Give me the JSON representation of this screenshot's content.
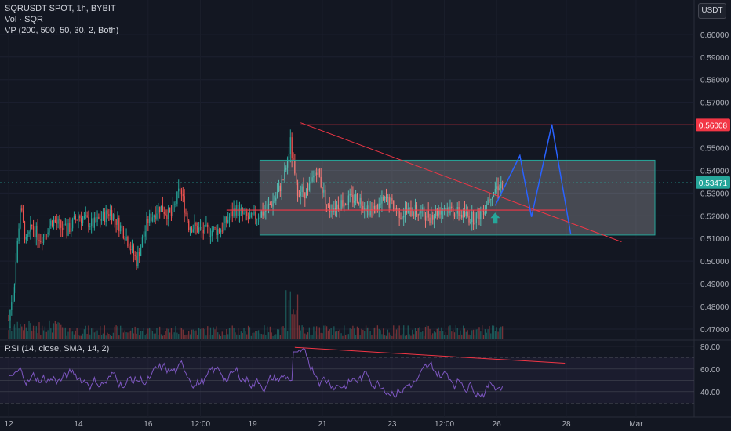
{
  "header": {
    "symbol_line": "SQRUSDT SPOT, 1h, BYBIT",
    "volume_line": "Vol · SQR",
    "vp_line": "VP (200, 500, 50, 30, 2, Both)",
    "currency_button": "USDT"
  },
  "rsi_legend": "RSI (14, close, SMA, 14, 2)",
  "colors": {
    "up": "#26a69a",
    "down": "#ef5350",
    "bg": "#131722",
    "box_fill": "#ffffff",
    "box_border": "#26a69a",
    "trend": "#f23645",
    "arrow": "#2962ff",
    "rsi_line": "#7e57c2"
  },
  "chart_data": {
    "type": "candlestick",
    "price_axis": {
      "ticks": [
        "0.60000",
        "0.59000",
        "0.58000",
        "0.57000",
        "0.56000",
        "0.55000",
        "0.54000",
        "0.53000",
        "0.52000",
        "0.51000",
        "0.50000",
        "0.49000",
        "0.48000",
        "0.47000"
      ],
      "ylim": [
        0.4655,
        0.6117
      ]
    },
    "price_labels": [
      {
        "text": "0.56008",
        "value": 0.56008,
        "color": "#f23645"
      },
      {
        "text": "0.53471",
        "value": 0.53471,
        "color": "#26a69a"
      }
    ],
    "time_axis": {
      "labels": [
        "12",
        "14",
        "16",
        "12:00",
        "19",
        "21",
        "23",
        "12:00",
        "26",
        "28",
        "Mar"
      ],
      "label_hours": [
        0,
        48,
        96,
        132,
        168,
        216,
        264,
        300,
        336,
        384,
        432
      ],
      "xlim_hours": [
        -6,
        472
      ]
    },
    "candles": {
      "start_hour": 0,
      "end_hour": 340,
      "highlights": [
        {
          "hour": 0,
          "price": 0.474
        },
        {
          "hour": 4,
          "price": 0.492
        },
        {
          "hour": 8,
          "price": 0.524
        },
        {
          "hour": 12,
          "price": 0.508
        },
        {
          "hour": 16,
          "price": 0.515
        },
        {
          "hour": 22,
          "price": 0.51
        },
        {
          "hour": 30,
          "price": 0.518
        },
        {
          "hour": 40,
          "price": 0.513
        },
        {
          "hour": 48,
          "price": 0.52
        },
        {
          "hour": 58,
          "price": 0.516
        },
        {
          "hour": 70,
          "price": 0.522
        },
        {
          "hour": 80,
          "price": 0.512
        },
        {
          "hour": 88,
          "price": 0.5
        },
        {
          "hour": 96,
          "price": 0.518
        },
        {
          "hour": 104,
          "price": 0.524
        },
        {
          "hour": 112,
          "price": 0.52
        },
        {
          "hour": 118,
          "price": 0.532
        },
        {
          "hour": 124,
          "price": 0.516
        },
        {
          "hour": 134,
          "price": 0.513
        },
        {
          "hour": 146,
          "price": 0.514
        },
        {
          "hour": 156,
          "price": 0.523
        },
        {
          "hour": 166,
          "price": 0.518
        },
        {
          "hour": 176,
          "price": 0.522
        },
        {
          "hour": 184,
          "price": 0.528
        },
        {
          "hour": 190,
          "price": 0.538
        },
        {
          "hour": 194,
          "price": 0.552
        },
        {
          "hour": 198,
          "price": 0.532
        },
        {
          "hour": 206,
          "price": 0.53
        },
        {
          "hour": 212,
          "price": 0.541
        },
        {
          "hour": 220,
          "price": 0.523
        },
        {
          "hour": 230,
          "price": 0.526
        },
        {
          "hour": 240,
          "price": 0.528
        },
        {
          "hour": 250,
          "price": 0.522
        },
        {
          "hour": 260,
          "price": 0.527
        },
        {
          "hour": 270,
          "price": 0.521
        },
        {
          "hour": 280,
          "price": 0.522
        },
        {
          "hour": 290,
          "price": 0.52
        },
        {
          "hour": 300,
          "price": 0.524
        },
        {
          "hour": 310,
          "price": 0.521
        },
        {
          "hour": 320,
          "price": 0.519
        },
        {
          "hour": 326,
          "price": 0.522
        },
        {
          "hour": 332,
          "price": 0.53
        },
        {
          "hour": 338,
          "price": 0.534
        },
        {
          "hour": 340,
          "price": 0.535
        }
      ]
    },
    "drawings": {
      "range_box": {
        "hour_start": 173,
        "hour_end": 445,
        "price_top": 0.5445,
        "price_bottom": 0.5115
      },
      "resistance": {
        "hour_start": 201,
        "hour_end": 472,
        "price": 0.56008
      },
      "mid_line": {
        "hour_start": 150,
        "hour_end": 383,
        "price": 0.5225
      },
      "descending_trend": {
        "hour_start": 201,
        "price_start": 0.561,
        "hour_end": 422,
        "price_end": 0.5085
      },
      "projection_arrow": [
        {
          "hour": 335,
          "price": 0.5245
        },
        {
          "hour": 352,
          "price": 0.5465
        },
        {
          "hour": 360,
          "price": 0.5195
        },
        {
          "hour": 374,
          "price": 0.5603
        },
        {
          "hour": 387,
          "price": 0.512
        }
      ],
      "up_arrow": {
        "hour": 335,
        "price": 0.519
      }
    },
    "volume_ratio_hint": "spike near hour 198",
    "rsi": {
      "levels": [
        80,
        70,
        60,
        50,
        40,
        30
      ],
      "labels": [
        "80.00",
        "60.00",
        "40.00"
      ],
      "ylim": [
        24,
        84
      ],
      "divergence_line": {
        "hour_start": 197,
        "value_start": 79,
        "hour_end": 383,
        "value_end": 65
      }
    }
  }
}
